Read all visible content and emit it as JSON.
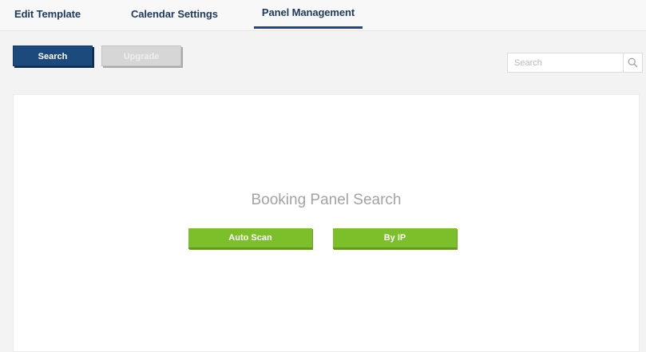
{
  "tabs": [
    {
      "label": "Edit Template",
      "active": false
    },
    {
      "label": "Calendar Settings",
      "active": false
    },
    {
      "label": "Panel Management",
      "active": true
    }
  ],
  "toolbar": {
    "search_label": "Search",
    "upgrade_label": "Upgrade"
  },
  "search": {
    "placeholder": "Search",
    "value": "",
    "icon": "search-icon"
  },
  "panel": {
    "title": "Booking Panel Search",
    "auto_scan_label": "Auto Scan",
    "by_ip_label": "By IP"
  },
  "colors": {
    "accent": "#1c4a7d",
    "primary_button": "#1c4a7d",
    "disabled_button": "#d6d6d6",
    "action_green": "#7bbf2a",
    "title_gray": "#a3a3a3"
  }
}
